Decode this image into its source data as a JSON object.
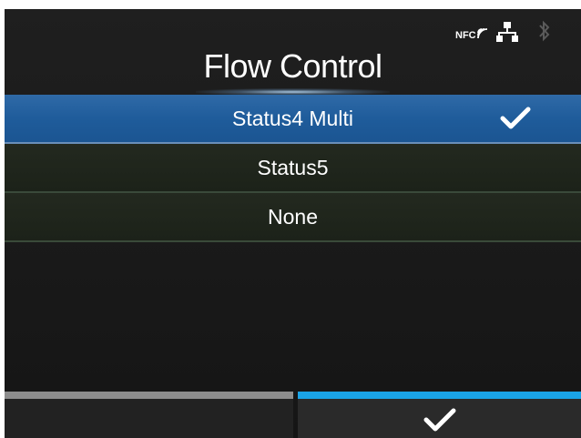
{
  "status_icons": {
    "nfc": "nfc-icon",
    "network": "network-icon",
    "bluetooth": "bluetooth-icon"
  },
  "title": "Flow Control",
  "options": [
    {
      "label": "Status4 Multi",
      "selected": true
    },
    {
      "label": "Status5",
      "selected": false
    },
    {
      "label": "None",
      "selected": false
    }
  ],
  "softkeys": {
    "left": {
      "icon": "none"
    },
    "right": {
      "icon": "checkmark-icon"
    }
  },
  "colors": {
    "selected_row": "#1f5c9b",
    "active_softkey": "#1aa3e6",
    "inactive_softkey": "#8c8c8c"
  }
}
